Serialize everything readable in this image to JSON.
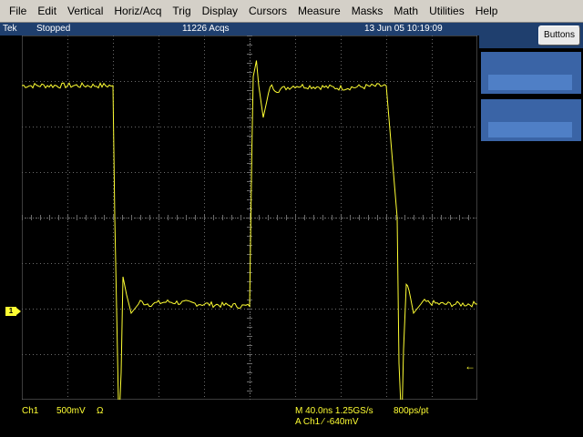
{
  "menu": [
    "File",
    "Edit",
    "Vertical",
    "Horiz/Acq",
    "Trig",
    "Display",
    "Cursors",
    "Measure",
    "Masks",
    "Math",
    "Utilities",
    "Help"
  ],
  "status": {
    "brand": "Tek",
    "state": "Stopped",
    "acqs": "11226 Acqs",
    "datetime": "13 Jun 05 10:19:09"
  },
  "right_panel": {
    "buttons_label": "Buttons"
  },
  "readout": {
    "channel": "Ch1",
    "volts_div": "500mV",
    "impedance": "Ω",
    "timebase": "M 40.0ns 1.25GS/s",
    "ps_per_pt": "800ps/pt",
    "trigger": "A  Ch1  ⁄  -640mV"
  },
  "markers": {
    "ch1": "1"
  },
  "colors": {
    "trace": "#ffff33",
    "status_bg": "#1f3f6e",
    "menu_bg": "#d4d0c8",
    "grid": "#6b6b6b",
    "trigger_marker": "#f08a24"
  },
  "chart_data": {
    "type": "line",
    "divisions": {
      "x": 10,
      "y": 8
    },
    "x_div_range": [
      0,
      10
    ],
    "y_div_range": [
      -4,
      4
    ],
    "series": [
      {
        "x": [
          0,
          2.0,
          2.04,
          2.1,
          2.13,
          2.18,
          2.22,
          2.3,
          2.4,
          2.6,
          2.8,
          3.2,
          4.0,
          5.0,
          5.05,
          5.08,
          5.15,
          5.2,
          5.3,
          5.45,
          5.6,
          6.0,
          7.0,
          8.0,
          8.24,
          8.28,
          8.34,
          8.38,
          8.44,
          8.5,
          8.6,
          8.8,
          9.2,
          10.0
        ],
        "y": [
          2.9,
          2.9,
          0.0,
          -3.0,
          -4.6,
          -3.4,
          -1.3,
          -1.7,
          -2.1,
          -1.85,
          -1.9,
          -1.85,
          -1.9,
          -1.95,
          1.5,
          3.1,
          3.45,
          2.9,
          2.2,
          2.9,
          2.8,
          2.9,
          2.85,
          2.9,
          0.0,
          -3.2,
          -4.6,
          -2.9,
          -1.5,
          -1.6,
          -2.1,
          -1.85,
          -1.9,
          -1.9
        ]
      }
    ]
  }
}
